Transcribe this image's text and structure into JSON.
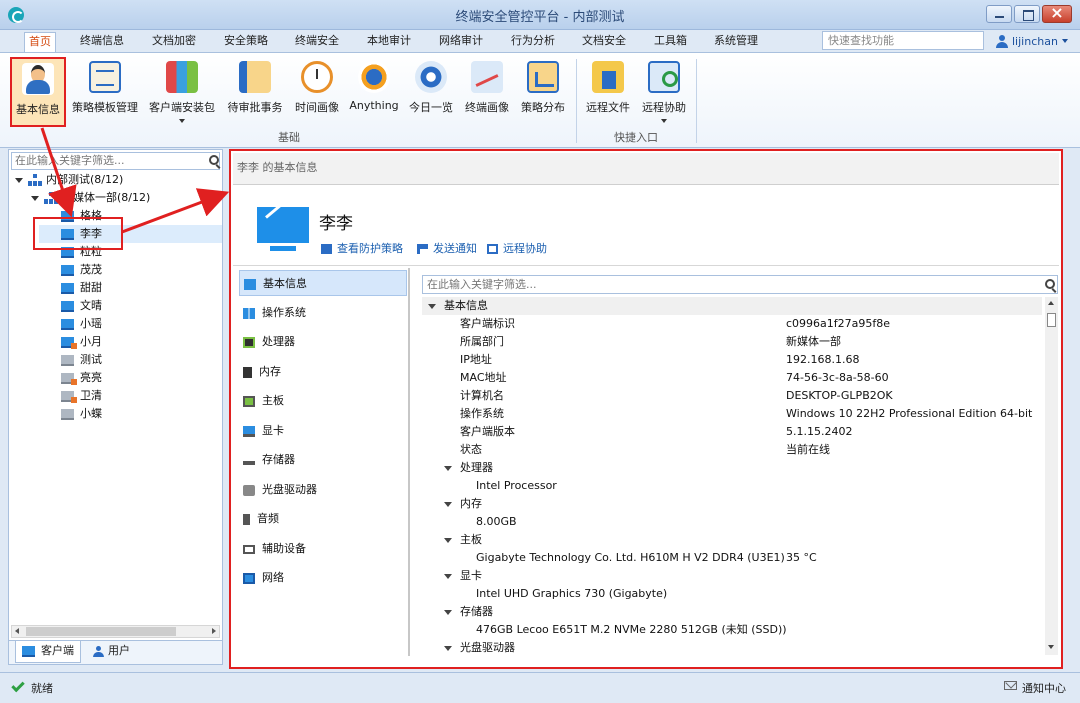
{
  "window": {
    "title": "终端安全管控平台 - 内部测试"
  },
  "menu": {
    "tabs": [
      "首页",
      "终端信息",
      "文档加密",
      "安全策略",
      "终端安全",
      "本地审计",
      "网络审计",
      "行为分析",
      "文档安全",
      "工具箱",
      "系统管理"
    ],
    "quick_search_placeholder": "快速查找功能",
    "user": "lijinchan"
  },
  "ribbon": {
    "group_basic": {
      "label": "基础",
      "buttons": [
        "基本信息",
        "策略模板管理",
        "客户端安装包",
        "待审批事务",
        "时间画像",
        "Anything",
        "今日一览",
        "终端画像",
        "策略分布"
      ]
    },
    "group_quick": {
      "label": "快捷入口",
      "buttons": [
        "远程文件",
        "远程协助"
      ]
    }
  },
  "tree": {
    "search_placeholder": "在此输入关键字筛选...",
    "root": "内部测试(8/12)",
    "dept": "新媒体一部(8/12)",
    "clients": [
      "格格",
      "李李",
      "粒粒",
      "茂茂",
      "甜甜",
      "文晴",
      "小瑶",
      "小月",
      "测试",
      "亮亮",
      "卫清",
      "小蝶"
    ]
  },
  "bottom_tabs": [
    "客户端",
    "用户"
  ],
  "detail": {
    "header": "李李 的基本信息",
    "client_name": "李李",
    "actions": [
      "查看防护策略",
      "发送通知",
      "远程协助"
    ],
    "categories": [
      "基本信息",
      "操作系统",
      "处理器",
      "内存",
      "主板",
      "显卡",
      "存储器",
      "光盘驱动器",
      "音频",
      "辅助设备",
      "网络"
    ],
    "search_placeholder": "在此输入关键字筛选...",
    "basic": {
      "section": "基本信息",
      "rows": [
        {
          "k": "客户端标识",
          "v": "c0996a1f27a95f8e"
        },
        {
          "k": "所属部门",
          "v": "新媒体一部"
        },
        {
          "k": "IP地址",
          "v": "192.168.1.68"
        },
        {
          "k": "MAC地址",
          "v": "74-56-3c-8a-58-60"
        },
        {
          "k": "计算机名",
          "v": "DESKTOP-GLPB2OK"
        },
        {
          "k": "操作系统",
          "v": "Windows 10 22H2 Professional Edition 64-bit"
        },
        {
          "k": "客户端版本",
          "v": "5.1.15.2402"
        },
        {
          "k": "状态",
          "v": "当前在线"
        }
      ]
    },
    "hardware": [
      {
        "section": "处理器",
        "value": "Intel Processor"
      },
      {
        "section": "内存",
        "value": "8.00GB"
      },
      {
        "section": "主板",
        "value": "Gigabyte Technology Co. Ltd. H610M H V2 DDR4 (U3E1)",
        "extra": "35 °C"
      },
      {
        "section": "显卡",
        "value": "Intel UHD Graphics 730 (Gigabyte)"
      },
      {
        "section": "存储器",
        "value": "476GB Lecoo E651T M.2 NVMe 2280 512GB (未知 (SSD))"
      },
      {
        "section": "光盘驱动器",
        "value": ""
      }
    ]
  },
  "status": {
    "text": "就绪",
    "notify": "通知中心"
  }
}
